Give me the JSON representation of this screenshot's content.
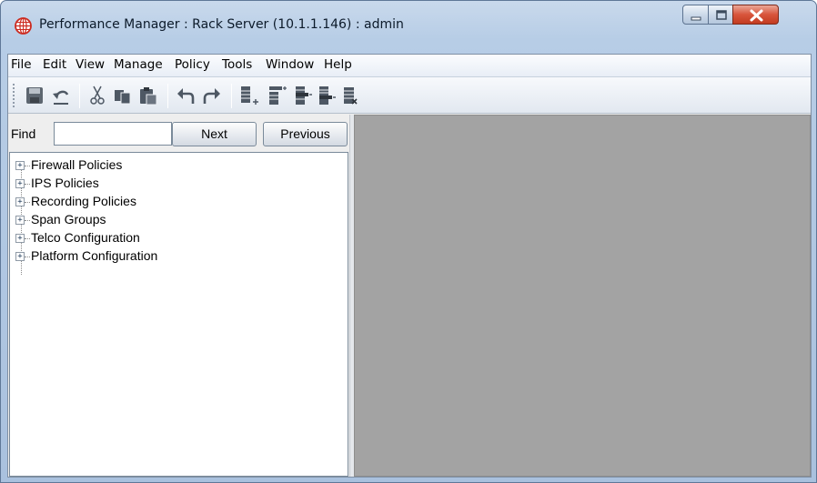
{
  "window": {
    "title": "Performance Manager : Rack Server (10.1.1.146) : admin",
    "icon": "globe-icon",
    "accent_color": "#cc2a1f"
  },
  "menu": {
    "items": [
      "File",
      "Edit",
      "View",
      "Manage",
      "Policy",
      "Tools",
      "Window",
      "Help"
    ]
  },
  "toolbar": {
    "buttons": [
      "save-icon",
      "undo-icon",
      "cut-icon",
      "copy-icon",
      "paste-icon",
      "undo-arrow-icon",
      "redo-arrow-icon",
      "add-row-icon",
      "insert-row-icon",
      "move-row-icon",
      "append-row-icon",
      "delete-row-icon"
    ]
  },
  "find": {
    "label": "Find",
    "value": "",
    "next_label": "Next",
    "previous_label": "Previous"
  },
  "tree": {
    "items": [
      {
        "label": "Firewall Policies"
      },
      {
        "label": "IPS Policies"
      },
      {
        "label": "Recording Policies"
      },
      {
        "label": "Span Groups"
      },
      {
        "label": "Telco Configuration"
      },
      {
        "label": "Platform Configuration"
      }
    ],
    "expander_symbol": "+"
  }
}
